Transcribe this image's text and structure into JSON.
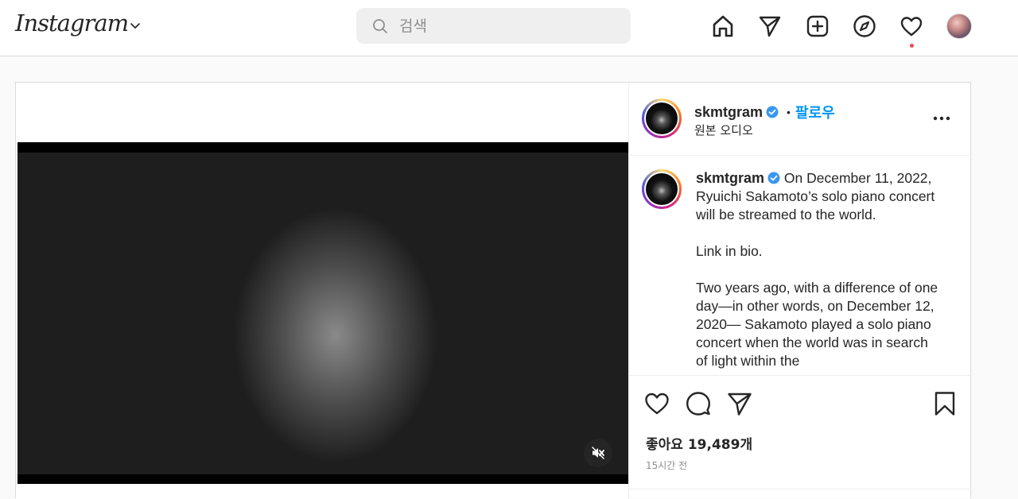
{
  "nav": {
    "logo": "Instagram",
    "search_placeholder": "검색",
    "icons": [
      "chevron-down-icon",
      "search-icon",
      "home-icon",
      "send-icon",
      "new-post-icon",
      "explore-icon",
      "heart-icon",
      "profile-avatar"
    ]
  },
  "post": {
    "username": "skmtgram",
    "follow_label": "팔로우",
    "separator": "•",
    "audio": "원본 오디오",
    "caption": {
      "username": "skmtgram",
      "paragraphs": [
        "On December 11, 2022, Ryuichi Sakamoto’s solo piano concert will be streamed to the world.",
        "Link in bio.",
        "Two years ago, with a difference of one day—in other words, on December 12, 2020— Sakamoto played a solo piano concert when the world was in search of light within the"
      ]
    },
    "likes": "좋아요 19,489개",
    "time_ago": "15시간 전"
  },
  "colors": {
    "follow_blue": "#0095f6",
    "verified_blue": "#3897f0",
    "notification_red": "#ed4956",
    "border": "#dbdbdb"
  }
}
